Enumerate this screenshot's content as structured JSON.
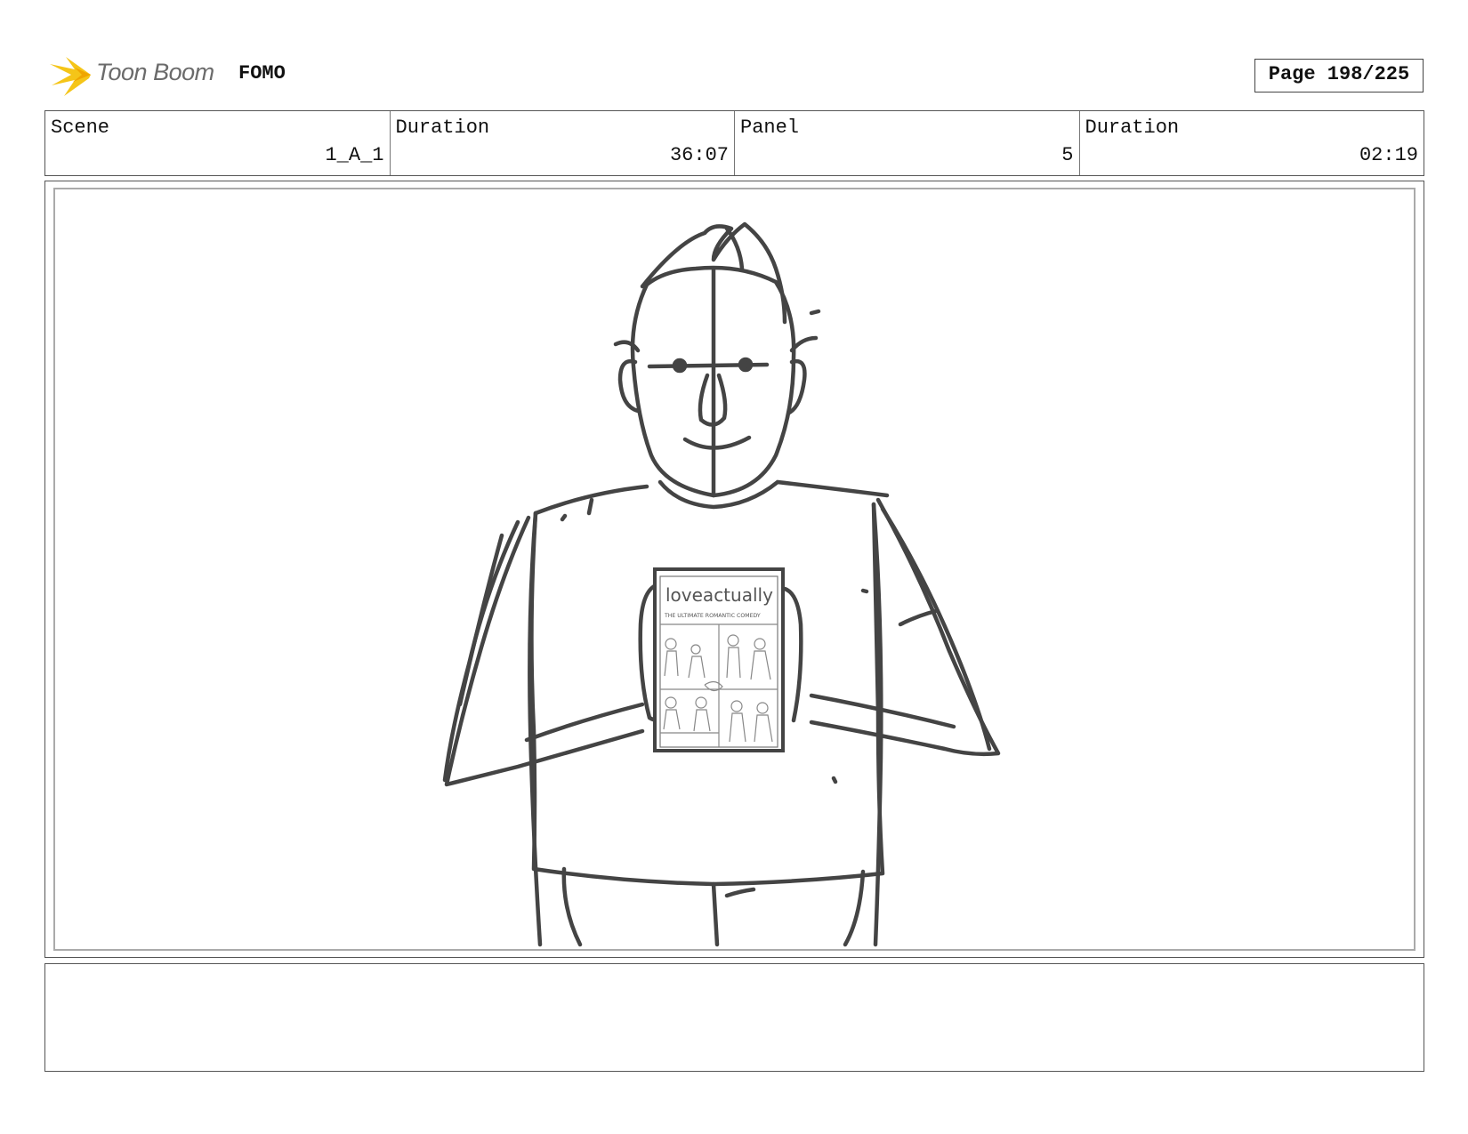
{
  "header": {
    "logo_text": "Toon Boom",
    "project_title": "FOMO",
    "page_label": "Page 198/225"
  },
  "info": [
    {
      "label": "Scene",
      "value": "1_A_1"
    },
    {
      "label": "Duration",
      "value": "36:07"
    },
    {
      "label": "Panel",
      "value": "5"
    },
    {
      "label": "Duration",
      "value": "02:19"
    }
  ],
  "panel": {
    "dvd_title": "loveactually",
    "dvd_subtitle": "THE ULTIMATE ROMANTIC COMEDY"
  },
  "colors": {
    "logo_accent": "#f5c518",
    "sketch_line": "#444444"
  }
}
